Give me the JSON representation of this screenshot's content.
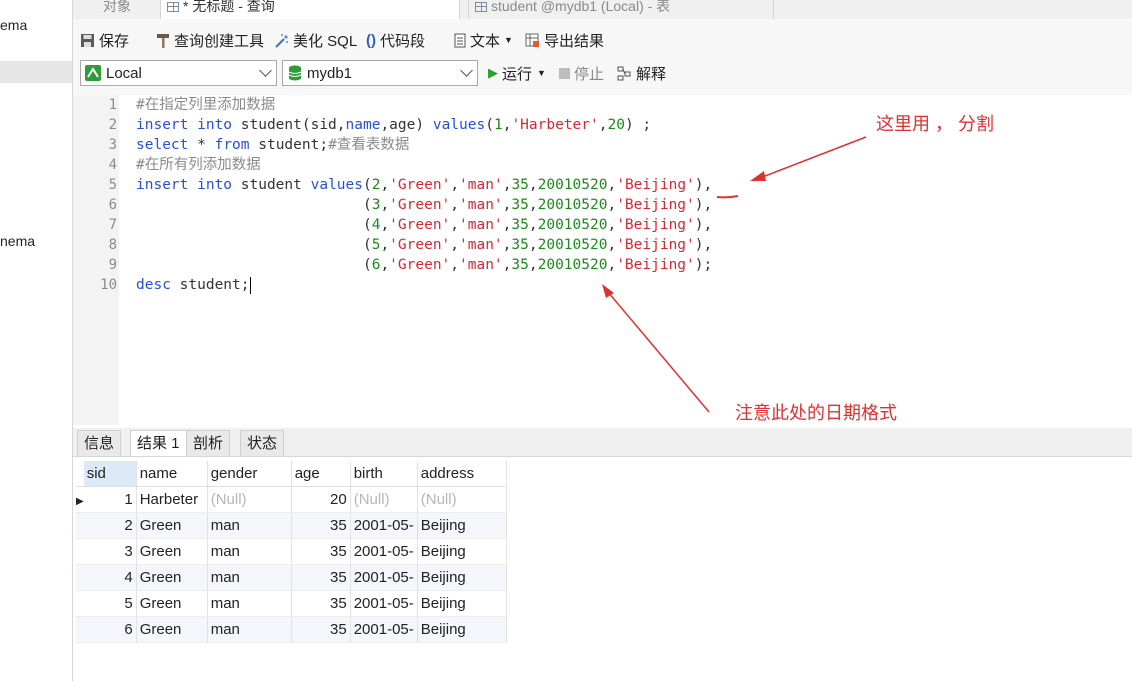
{
  "left_panel": {
    "item1": "ema",
    "item2": "nema"
  },
  "tabs": [
    {
      "label": "对象"
    },
    {
      "label": "* 无标题 - 查询"
    },
    {
      "label": "student @mydb1 (Local) - 表"
    }
  ],
  "toolbar": {
    "save": "保存",
    "query_builder": "查询创建工具",
    "beautify_sql": "美化 SQL",
    "code_snippet": "代码段",
    "text": "文本",
    "export": "导出结果",
    "connection": "Local",
    "database": "mydb1",
    "run": "运行",
    "stop": "停止",
    "explain": "解释"
  },
  "editor": {
    "line_numbers": [
      "1",
      "2",
      "3",
      "4",
      "5",
      "6",
      "7",
      "8",
      "9",
      "10"
    ]
  },
  "annotations": {
    "comma_note": "这里用 ， 分割",
    "date_note": "注意此处的日期格式"
  },
  "result_tabs": [
    "信息",
    "结果 1",
    "剖析",
    "状态"
  ],
  "grid": {
    "columns": [
      "sid",
      "name",
      "gender",
      "age",
      "birth",
      "address"
    ],
    "rows": [
      {
        "sid": "1",
        "name": "Harbeter",
        "gender": "(Null)",
        "age": "20",
        "birth": "(Null)",
        "address": "(Null)"
      },
      {
        "sid": "2",
        "name": "Green",
        "gender": "man",
        "age": "35",
        "birth": "2001-05-",
        "address": "Beijing"
      },
      {
        "sid": "3",
        "name": "Green",
        "gender": "man",
        "age": "35",
        "birth": "2001-05-",
        "address": "Beijing"
      },
      {
        "sid": "4",
        "name": "Green",
        "gender": "man",
        "age": "35",
        "birth": "2001-05-",
        "address": "Beijing"
      },
      {
        "sid": "5",
        "name": "Green",
        "gender": "man",
        "age": "35",
        "birth": "2001-05-",
        "address": "Beijing"
      },
      {
        "sid": "6",
        "name": "Green",
        "gender": "man",
        "age": "35",
        "birth": "2001-05-",
        "address": "Beijing"
      }
    ]
  }
}
